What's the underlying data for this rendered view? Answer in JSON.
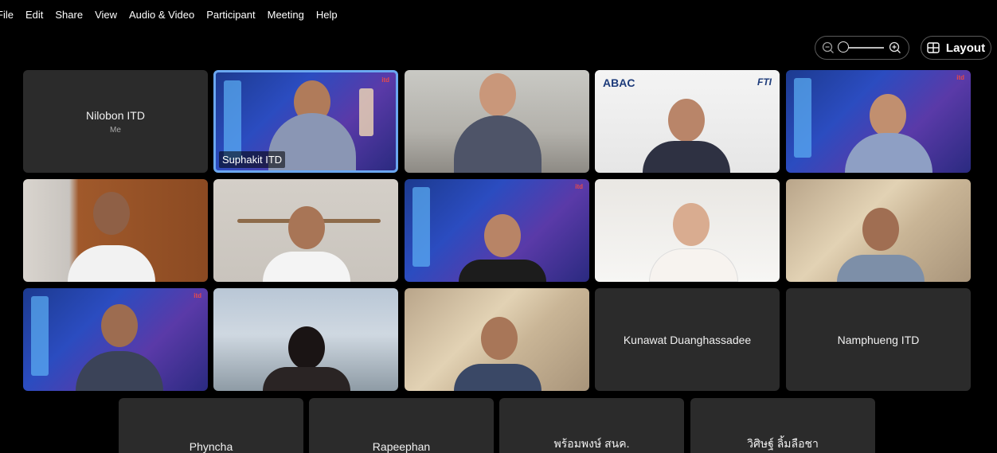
{
  "menu": [
    "File",
    "Edit",
    "Share",
    "View",
    "Audio & Video",
    "Participant",
    "Meeting",
    "Help"
  ],
  "controls": {
    "zoom_out_icon": "zoom-out-icon",
    "zoom_in_icon": "zoom-in-icon",
    "zoom_level": 0,
    "layout_label": "Layout"
  },
  "tiles": {
    "nilobon": {
      "name": "Nilobon ITD",
      "sub": "Me"
    },
    "suphakit": {
      "name": "Suphakit ITD"
    },
    "abac": {
      "logo": "ABAC",
      "logo_fti": "FTI"
    },
    "kunawat": {
      "name": "Kunawat Duanghassadee"
    },
    "namphueng": {
      "name": "Namphueng ITD"
    },
    "phyncha": {
      "name": "Phyncha"
    },
    "rapeephan": {
      "name": "Rapeephan"
    },
    "phromphong": {
      "name": "พร้อมพงษ์ สนค."
    },
    "wisit": {
      "name": "วิศิษฐ์ ลิ้มลือชา"
    }
  }
}
